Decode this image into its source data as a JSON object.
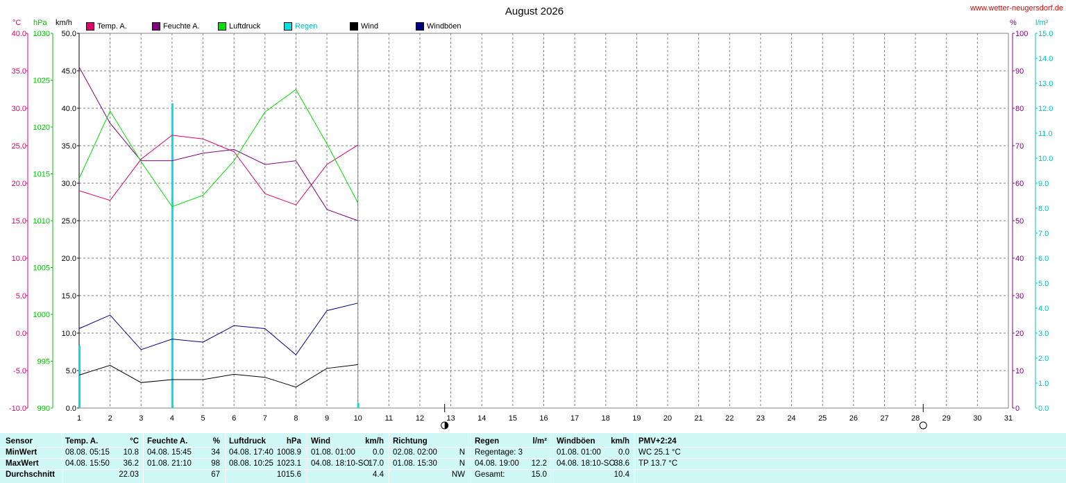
{
  "title": "August 2026",
  "site": "www.wetter-neugersdorf.de",
  "units": {
    "temp": "°C",
    "press": "hPa",
    "wind": "km/h",
    "hum": "%",
    "rain": "l/m²"
  },
  "legend": [
    {
      "label": "Temp. A.",
      "color": "#e0006e"
    },
    {
      "label": "Feuchte A.",
      "color": "#800080"
    },
    {
      "label": "Luftdruck",
      "color": "#00e000"
    },
    {
      "label": "Regen",
      "color": "#00e0e0"
    },
    {
      "label": "Wind",
      "color": "#000000"
    },
    {
      "label": "Windböen",
      "color": "#000080"
    }
  ],
  "colors": {
    "temp": "#e0006e",
    "hum": "#800080",
    "press": "#00e000",
    "rain": "#00e0e0",
    "wind": "#000000",
    "gust": "#000080",
    "grid": "#808080"
  },
  "chart_data": {
    "type": "line",
    "x": [
      1,
      2,
      3,
      4,
      5,
      6,
      7,
      8,
      9,
      10
    ],
    "xlim": [
      1,
      31
    ],
    "x_ticks": [
      1,
      2,
      3,
      4,
      5,
      6,
      7,
      8,
      9,
      10,
      11,
      12,
      13,
      14,
      15,
      16,
      17,
      18,
      19,
      20,
      21,
      22,
      23,
      24,
      25,
      26,
      27,
      28,
      29,
      30,
      31
    ],
    "axes": {
      "temp": {
        "unit": "°C",
        "range": [
          -10,
          40
        ],
        "ticks": [
          -10,
          -5,
          0,
          5,
          10,
          15,
          20,
          25,
          30,
          35,
          40
        ],
        "side": "left"
      },
      "press": {
        "unit": "hPa",
        "range": [
          990,
          1030
        ],
        "ticks": [
          990,
          995,
          1000,
          1005,
          1010,
          1015,
          1020,
          1025,
          1030
        ],
        "side": "left"
      },
      "wind": {
        "unit": "km/h",
        "range": [
          0,
          50
        ],
        "ticks": [
          0,
          5,
          10,
          15,
          20,
          25,
          30,
          35,
          40,
          45,
          50
        ],
        "side": "left"
      },
      "hum": {
        "unit": "%",
        "range": [
          0,
          100
        ],
        "ticks": [
          0,
          10,
          20,
          30,
          40,
          50,
          60,
          70,
          80,
          90,
          100
        ],
        "side": "right"
      },
      "rain": {
        "unit": "l/m²",
        "range": [
          0,
          15
        ],
        "ticks": [
          0,
          1,
          2,
          3,
          4,
          5,
          6,
          7,
          8,
          9,
          10,
          11,
          12,
          13,
          14,
          15
        ],
        "side": "right"
      }
    },
    "series": [
      {
        "name": "Temp. A.",
        "axis": "temp",
        "color": "#e0006e",
        "values": [
          19.0,
          17.7,
          23.2,
          26.4,
          25.9,
          24.2,
          18.6,
          17.1,
          22.5,
          25.1
        ]
      },
      {
        "name": "Feuchte A.",
        "axis": "hum",
        "color": "#800080",
        "values": [
          91,
          76,
          66,
          66,
          68,
          69,
          65,
          66,
          53,
          50
        ]
      },
      {
        "name": "Luftdruck",
        "axis": "press",
        "color": "#00e000",
        "values": [
          1014.5,
          1021.7,
          1016.3,
          1011.5,
          1012.7,
          1016.4,
          1021.6,
          1024.0,
          1018.2,
          1011.9
        ]
      },
      {
        "name": "Wind",
        "axis": "wind",
        "color": "#000000",
        "values": [
          4.4,
          5.7,
          3.4,
          3.8,
          3.8,
          4.5,
          4.1,
          2.8,
          5.3,
          5.8
        ]
      },
      {
        "name": "Windböen",
        "axis": "wind",
        "color": "#000080",
        "values": [
          10.6,
          12.4,
          7.8,
          9.2,
          8.8,
          11.0,
          10.6,
          7.1,
          13.0,
          14.0
        ]
      }
    ],
    "rain_bars": [
      {
        "x": 1,
        "value": 2.5
      },
      {
        "x": 4,
        "value": 12.2
      },
      {
        "x": 10,
        "value": 0.2
      }
    ],
    "moon_phases": [
      {
        "x": 12.8,
        "phase": "half"
      },
      {
        "x": 28.25,
        "phase": "full"
      }
    ]
  },
  "stats": {
    "sensor": {
      "header": "Sensor",
      "rows": [
        "MinWert",
        "MaxWert",
        "Durchschnitt"
      ]
    },
    "temp": {
      "header": "Temp. A.",
      "unit": "°C",
      "rows": [
        {
          "t": "08.08.  05:15",
          "v": "10.8"
        },
        {
          "t": "04.08.  15:50",
          "v": "36.2"
        },
        {
          "t": "",
          "v": "22.03"
        }
      ]
    },
    "hum": {
      "header": "Feuchte A.",
      "unit": "%",
      "rows": [
        {
          "t": "04.08.  15:45",
          "v": "34"
        },
        {
          "t": "01.08.  21:10",
          "v": "98"
        },
        {
          "t": "",
          "v": "67"
        }
      ]
    },
    "press": {
      "header": "Luftdruck",
      "unit": "hPa",
      "rows": [
        {
          "t": "04.08.  17:40",
          "v": "1008.9"
        },
        {
          "t": "08.08.  10:25",
          "v": "1023.1"
        },
        {
          "t": "",
          "v": "1015.6"
        }
      ]
    },
    "wind": {
      "header": "Wind",
      "unit": "km/h",
      "rows": [
        {
          "t": "01.08.  01:00",
          "v": "0.0"
        },
        {
          "t": "04.08.  18:10-SO",
          "v": "17.0"
        },
        {
          "t": "",
          "v": "4.4"
        }
      ]
    },
    "dir": {
      "header": "Richtung",
      "unit": "",
      "rows": [
        {
          "t": "02.08.  02:00",
          "v": "N"
        },
        {
          "t": "01.08.  15:30",
          "v": "N"
        },
        {
          "t": "",
          "v": "NW"
        }
      ]
    },
    "rain": {
      "header": "Regen",
      "unit": "l/m²",
      "rows": [
        {
          "t": "Regentage: 3",
          "v": ""
        },
        {
          "t": "04.08.  19:00",
          "v": "12.2"
        },
        {
          "t": "Gesamt:",
          "v": "15.0"
        }
      ]
    },
    "gust": {
      "header": "Windböen",
      "unit": "km/h",
      "rows": [
        {
          "t": "01.08.  01:00",
          "v": "0.0"
        },
        {
          "t": "04.08.  18:10-SO",
          "v": "38.6"
        },
        {
          "t": "",
          "v": "10.4"
        }
      ]
    },
    "pmv": {
      "header": "PMV+2:24",
      "rows": [
        "WC 25.1 °C",
        "TP 13.7 °C",
        ""
      ]
    }
  }
}
